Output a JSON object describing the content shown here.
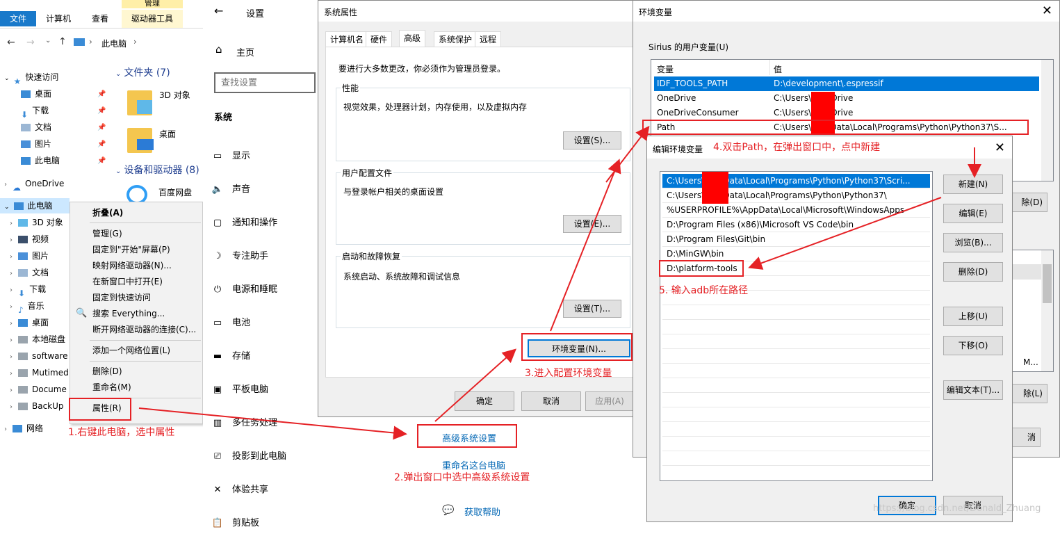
{
  "explorer": {
    "ribbon_tabs": [
      "文件",
      "计算机",
      "查看",
      "驱动器工具"
    ],
    "ribbon_group": "管理",
    "path": "此电脑",
    "sidebar": [
      {
        "label": "快速访问"
      },
      {
        "label": "桌面"
      },
      {
        "label": "下载"
      },
      {
        "label": "文档"
      },
      {
        "label": "图片"
      },
      {
        "label": "此电脑"
      },
      {
        "label": "OneDrive"
      },
      {
        "label": "此电脑"
      },
      {
        "label": "3D 对象"
      },
      {
        "label": "视频"
      },
      {
        "label": "图片"
      },
      {
        "label": "文档"
      },
      {
        "label": "下载"
      },
      {
        "label": "音乐"
      },
      {
        "label": "桌面"
      },
      {
        "label": "本地磁盘"
      },
      {
        "label": "software"
      },
      {
        "label": "Mutimed"
      },
      {
        "label": "Docume"
      },
      {
        "label": "BackUp"
      },
      {
        "label": "网络"
      }
    ],
    "folders_header": "文件夹 (7)",
    "folders": [
      "3D 对象",
      "桌面"
    ],
    "devices_header": "设备和驱动器 (8)",
    "devices": [
      "百度网盘"
    ]
  },
  "context_menu": {
    "items": [
      "折叠(A)",
      "管理(G)",
      "固定到\"开始\"屏幕(P)",
      "映射网络驱动器(N)...",
      "在新窗口中打开(E)",
      "固定到快速访问",
      "搜索 Everything...",
      "断开网络驱动器的连接(C)...",
      "添加一个网络位置(L)",
      "删除(D)",
      "重命名(M)",
      "属性(R)"
    ]
  },
  "settings": {
    "title": "设置",
    "home": "主页",
    "search_placeholder": "查找设置",
    "section": "系统",
    "items": [
      "显示",
      "声音",
      "通知和操作",
      "专注助手",
      "电源和睡眠",
      "电池",
      "存储",
      "平板电脑",
      "多任务处理",
      "投影到此电脑",
      "体验共享",
      "剪贴板"
    ],
    "links": {
      "advanced": "高级系统设置",
      "rename": "重命名这台电脑",
      "help": "获取帮助"
    }
  },
  "sysprops": {
    "title": "系统属性",
    "tabs": [
      "计算机名",
      "硬件",
      "高级",
      "系统保护",
      "远程"
    ],
    "admin_note": "要进行大多数更改，你必须作为管理员登录。",
    "perf": {
      "label": "性能",
      "desc": "视觉效果，处理器计划，内存使用，以及虚拟内存",
      "button": "设置(S)..."
    },
    "profile": {
      "label": "用户配置文件",
      "desc": "与登录帐户相关的桌面设置",
      "button": "设置(E)..."
    },
    "startup": {
      "label": "启动和故障恢复",
      "desc": "系统启动、系统故障和调试信息",
      "button": "设置(T)..."
    },
    "env_button": "环境变量(N)...",
    "ok": "确定",
    "cancel": "取消",
    "apply": "应用(A)"
  },
  "envvars": {
    "title": "环境变量",
    "user_group": "Sirius 的用户变量(U)",
    "col_var": "变量",
    "col_val": "值",
    "rows": [
      {
        "name": "IDF_TOOLS_PATH",
        "value": "D:\\development\\.espressif"
      },
      {
        "name": "OneDrive",
        "value": "C:\\Users\\        OneDrive"
      },
      {
        "name": "OneDriveConsumer",
        "value": "C:\\Users\\        OneDrive"
      },
      {
        "name": "Path",
        "value": "C:\\Users\\        AppData\\Local\\Programs\\Python\\Python37\\S..."
      }
    ],
    "btn_partial_1": "除(D)",
    "btn_partial_2": "除(L)",
    "btn_partial_3": "消",
    "partial_scroll_text": "M..."
  },
  "edit_env": {
    "title": "编辑环境变量",
    "paths": [
      "C:\\Users\\        AppData\\Local\\Programs\\Python\\Python37\\Scri...",
      "C:\\Users\\        AppData\\Local\\Programs\\Python\\Python37\\",
      "%USERPROFILE%\\AppData\\Local\\Microsoft\\WindowsApps",
      "D:\\Program Files (x86)\\Microsoft VS Code\\bin",
      "D:\\Program Files\\Git\\bin",
      "D:\\MinGW\\bin",
      "D:\\platform-tools"
    ],
    "buttons": [
      "新建(N)",
      "编辑(E)",
      "浏览(B)...",
      "删除(D)",
      "上移(U)",
      "下移(O)",
      "编辑文本(T)..."
    ],
    "ok": "确定",
    "cancel": "取消"
  },
  "annotations": {
    "step1": "1.右键此电脑，选中属性",
    "step2": "2.弹出窗口中选中高级系统设置",
    "step3": "3.进入配置环境变量",
    "step4": "4.双击Path，在弹出窗口中，点中新建",
    "step5": "5. 输入adb所在路径"
  },
  "watermark": "https://blog.csdn.net/Donald_Zhuang",
  "colors": {
    "accent": "#0078d7",
    "annotation": "#e52125",
    "selection": "#cce8ff"
  }
}
